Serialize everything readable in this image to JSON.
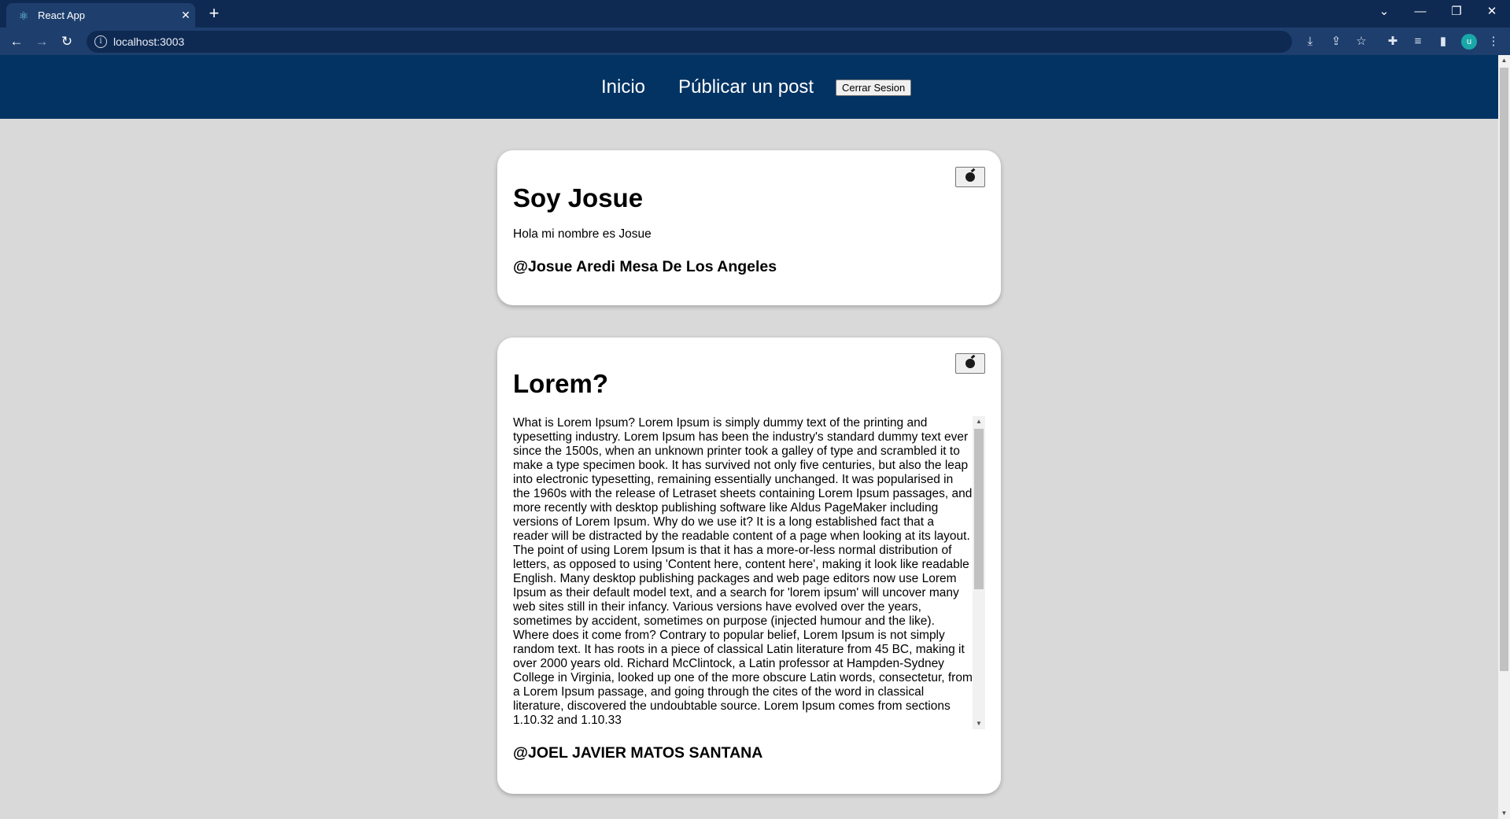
{
  "browser": {
    "tab_title": "React App",
    "url": "localhost:3003",
    "profile_initial": "u"
  },
  "nav": {
    "home_label": "Inicio",
    "publish_label": "Públicar un post",
    "logout_label": "Cerrar Sesion"
  },
  "posts": [
    {
      "title": "Soy Josue",
      "body": "Hola mi nombre es Josue",
      "author": "@Josue Aredi Mesa De Los Angeles"
    },
    {
      "title": "Lorem?",
      "body": "What is Lorem Ipsum? Lorem Ipsum is simply dummy text of the printing and typesetting industry. Lorem Ipsum has been the industry's standard dummy text ever since the 1500s, when an unknown printer took a galley of type and scrambled it to make a type specimen book. It has survived not only five centuries, but also the leap into electronic typesetting, remaining essentially unchanged. It was popularised in the 1960s with the release of Letraset sheets containing Lorem Ipsum passages, and more recently with desktop publishing software like Aldus PageMaker including versions of Lorem Ipsum. Why do we use it? It is a long established fact that a reader will be distracted by the readable content of a page when looking at its layout. The point of using Lorem Ipsum is that it has a more-or-less normal distribution of letters, as opposed to using 'Content here, content here', making it look like readable English. Many desktop publishing packages and web page editors now use Lorem Ipsum as their default model text, and a search for 'lorem ipsum' will uncover many web sites still in their infancy. Various versions have evolved over the years, sometimes by accident, sometimes on purpose (injected humour and the like). Where does it come from? Contrary to popular belief, Lorem Ipsum is not simply random text. It has roots in a piece of classical Latin literature from 45 BC, making it over 2000 years old. Richard McClintock, a Latin professor at Hampden-Sydney College in Virginia, looked up one of the more obscure Latin words, consectetur, from a Lorem Ipsum passage, and going through the cites of the word in classical literature, discovered the undoubtable source. Lorem Ipsum comes from sections 1.10.32 and 1.10.33",
      "author": "@JOEL JAVIER MATOS SANTANA"
    }
  ],
  "colors": {
    "navbar": "#023363",
    "page_bg": "#d9d9d9",
    "card_bg": "#ffffff",
    "chrome_frame": "#0f2a52"
  }
}
